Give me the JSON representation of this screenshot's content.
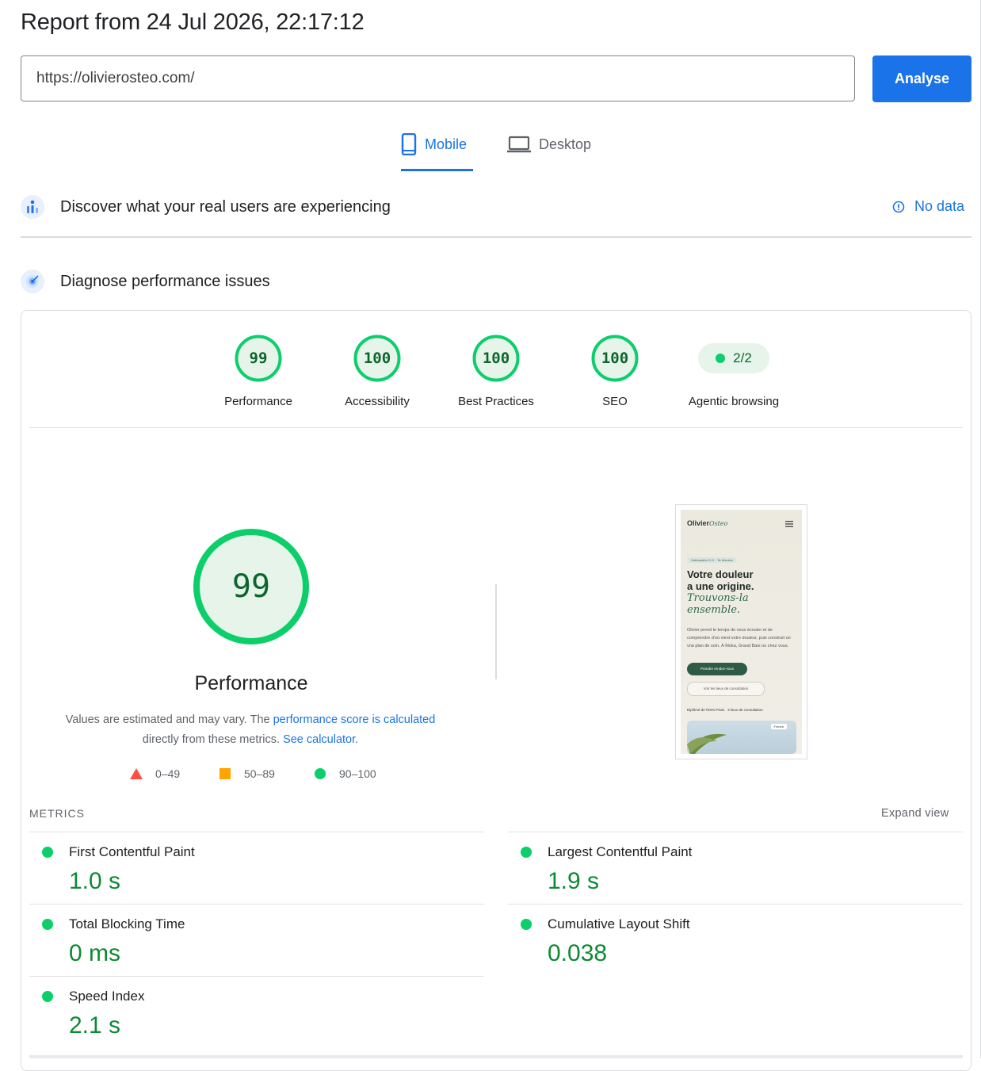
{
  "header": {
    "title": "Report from 24 Jul 2026, 22:17:12"
  },
  "search": {
    "url_value": "https://olivierosteo.com/",
    "analyse_label": "Analyse"
  },
  "tabs": [
    {
      "label": "Mobile",
      "icon": "smartphone-icon",
      "active": true
    },
    {
      "label": "Desktop",
      "icon": "laptop-icon",
      "active": false
    }
  ],
  "real_users": {
    "title": "Discover what your real users are experiencing",
    "status_label": "No data"
  },
  "diagnose": {
    "title": "Diagnose performance issues"
  },
  "categories": [
    {
      "label": "Performance",
      "score": "99"
    },
    {
      "label": "Accessibility",
      "score": "100"
    },
    {
      "label": "Best Practices",
      "score": "100"
    },
    {
      "label": "SEO",
      "score": "100"
    },
    {
      "label": "Agentic browsing",
      "score": "2/2"
    }
  ],
  "performance": {
    "score": "99",
    "title": "Performance",
    "desc_prefix": "Values are estimated and may vary. The ",
    "desc_link": "performance score is calculated",
    "desc_middle": "directly from these metrics. ",
    "desc_link2": "See calculator."
  },
  "legend": [
    {
      "label": "0–49",
      "color": "#ff4e42"
    },
    {
      "label": "50–89",
      "color": "#ffa400"
    },
    {
      "label": "90–100",
      "color": "#0cce6b"
    }
  ],
  "screenshot": {
    "brand": "Olivier",
    "brand_script": "Osteo",
    "tag": "Ostéopathe D.O. · Île Maurice",
    "headline_1": "Votre douleur",
    "headline_2": "a une origine.",
    "headline_3": "Trouvons-la",
    "headline_4": "ensemble.",
    "body": "Olivier prend le temps de vous écouter et de comprendre d'où vient votre douleur, puis construit un vrai plan de soin. À Moka, Grand Baie ou chez vous.",
    "cta_primary": "Prendre rendez-vous",
    "cta_secondary": "Voir les lieux de consultation",
    "stat_1": "Diplômé de l'EOO Paris",
    "stat_2": "3 lieux de consultation",
    "lang": "French"
  },
  "metrics": {
    "section_label": "METRICS",
    "expand_label": "Expand view",
    "items": [
      {
        "name": "First Contentful Paint",
        "value": "1.0 s"
      },
      {
        "name": "Largest Contentful Paint",
        "value": "1.9 s"
      },
      {
        "name": "Total Blocking Time",
        "value": "0 ms"
      },
      {
        "name": "Cumulative Layout Shift",
        "value": "0.038"
      },
      {
        "name": "Speed Index",
        "value": "2.1 s"
      }
    ]
  },
  "colors": {
    "accent": "#1a73e8",
    "pass": "#0cce6b",
    "pass_text": "#0d652d"
  }
}
